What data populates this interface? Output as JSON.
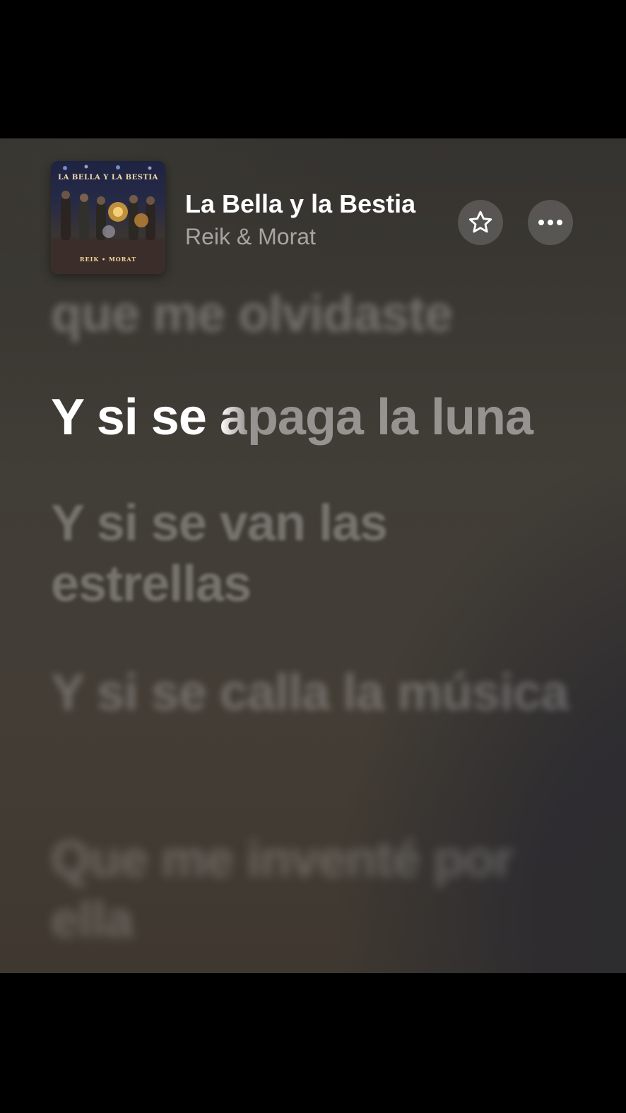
{
  "now_playing": {
    "title": "La Bella y la Bestia",
    "artist": "Reik & Morat",
    "artwork": {
      "title_text": "LA BELLA Y LA BESTIA",
      "artist_text": "REIK • MORAT"
    },
    "favorite_icon": "star-icon",
    "more_icon": "ellipsis-icon"
  },
  "lyrics": {
    "past_line": "que me olvidaste",
    "current_line": {
      "sung": "Y si se ",
      "in_progress": "a",
      "unsung": "paga la luna"
    },
    "upcoming_lines": [
      "Y si se van las estrellas",
      "Y si se calla la música",
      "Que me inventé por ella"
    ]
  },
  "colors": {
    "background": "#3f3a34",
    "active_lyric": "#ffffff",
    "inactive_lyric": "#8a8680"
  }
}
